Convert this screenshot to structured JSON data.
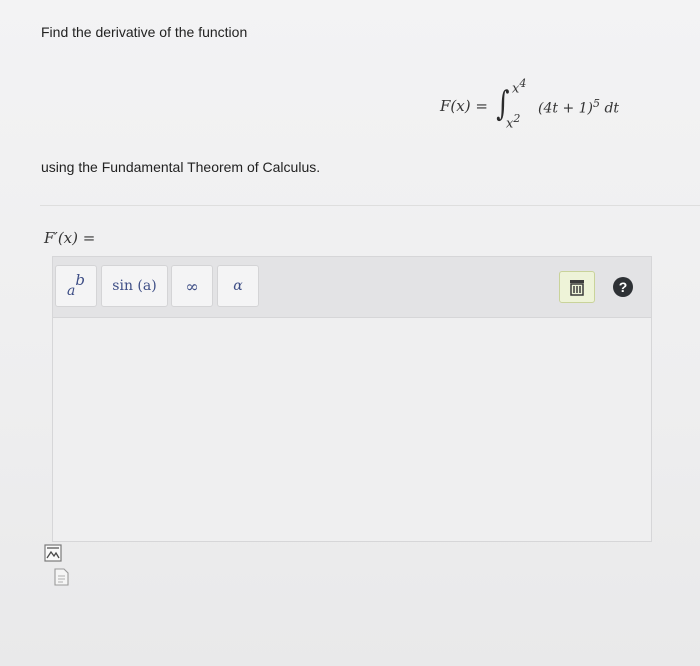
{
  "question": {
    "intro": "Find the derivative of the function",
    "using": "using the Fundamental Theorem of Calculus."
  },
  "formula": {
    "lhs": "F(x) =",
    "upper_base": "x",
    "upper_exp": "4",
    "lower_base": "x",
    "lower_exp": "2",
    "integrand": "(4t + 1)",
    "integrand_exp": "5",
    "differential": "dt"
  },
  "answer_label": "F′(x) =",
  "toolbar": {
    "power": {
      "base": "a",
      "exp": "b"
    },
    "sin_label": "sin (a)",
    "infinity_label": "∞",
    "alpha_label": "α",
    "help_label": "?"
  },
  "icons": {
    "power": "power-icon",
    "trash": "trash-icon",
    "help": "help-icon",
    "preview": "preview-icon",
    "file": "file-icon"
  },
  "colors": {
    "toolbar_text": "#3e4e86",
    "trash_bg": "#eef3d8",
    "help_bg": "#2e3135"
  }
}
